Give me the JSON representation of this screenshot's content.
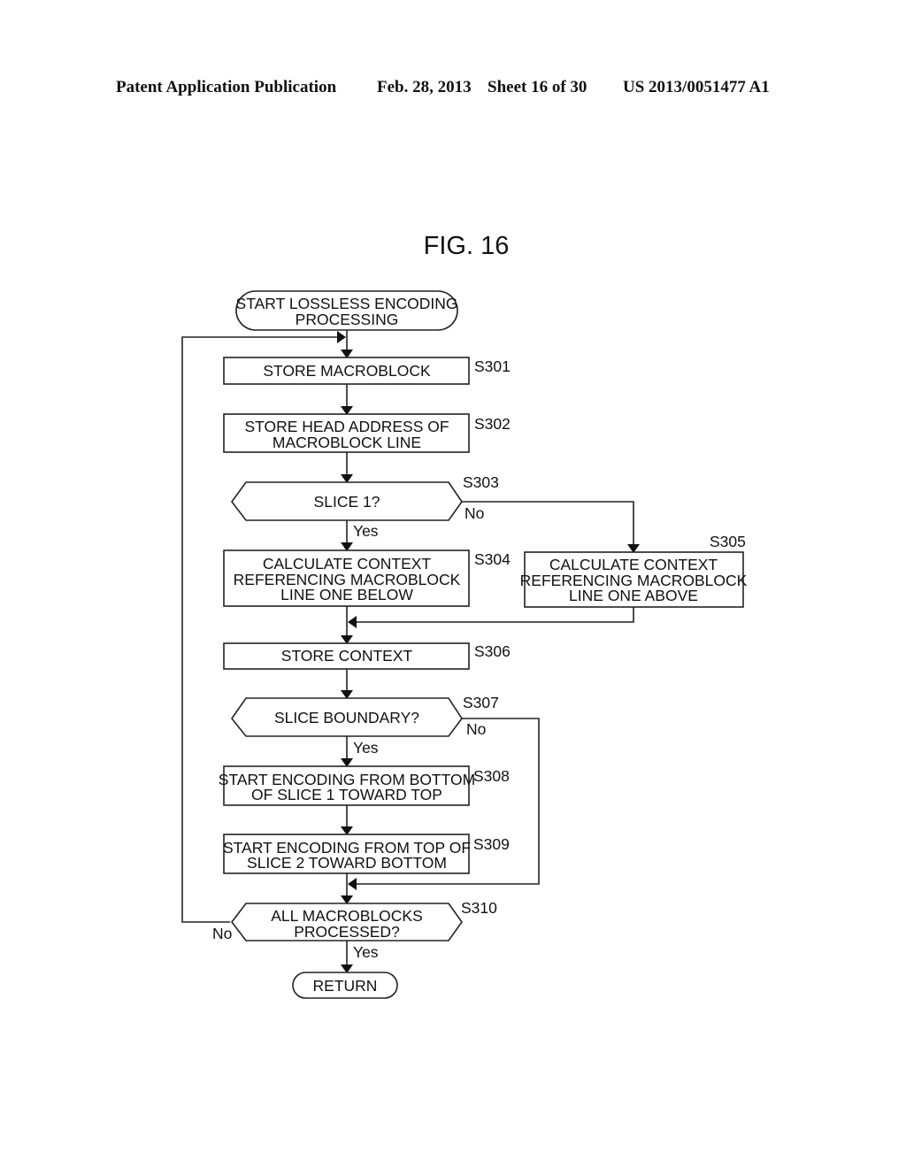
{
  "header": {
    "publication": "Patent Application Publication",
    "date": "Feb. 28, 2013",
    "sheet": "Sheet 16 of 30",
    "number": "US 2013/0051477 A1"
  },
  "figure": {
    "title": "FIG. 16",
    "start": [
      "START LOSSLESS ENCODING",
      "PROCESSING"
    ],
    "end": "RETURN",
    "steps": [
      {
        "id": "S301",
        "type": "process",
        "lines": [
          "STORE MACROBLOCK"
        ]
      },
      {
        "id": "S302",
        "type": "process",
        "lines": [
          "STORE HEAD ADDRESS OF",
          "MACROBLOCK LINE"
        ]
      },
      {
        "id": "S303",
        "type": "decision",
        "lines": [
          "SLICE 1?"
        ],
        "yes": "Yes",
        "no": "No"
      },
      {
        "id": "S304",
        "type": "process",
        "lines": [
          "CALCULATE CONTEXT",
          "REFERENCING MACROBLOCK",
          "LINE ONE BELOW"
        ]
      },
      {
        "id": "S305",
        "type": "process",
        "lines": [
          "CALCULATE CONTEXT",
          "REFERENCING MACROBLOCK",
          "LINE ONE ABOVE"
        ]
      },
      {
        "id": "S306",
        "type": "process",
        "lines": [
          "STORE CONTEXT"
        ]
      },
      {
        "id": "S307",
        "type": "decision",
        "lines": [
          "SLICE BOUNDARY?"
        ],
        "yes": "Yes",
        "no": "No"
      },
      {
        "id": "S308",
        "type": "process",
        "lines": [
          "START ENCODING FROM BOTTOM",
          "OF SLICE 1 TOWARD TOP"
        ]
      },
      {
        "id": "S309",
        "type": "process",
        "lines": [
          "START ENCODING FROM TOP OF",
          "SLICE 2 TOWARD BOTTOM"
        ]
      },
      {
        "id": "S310",
        "type": "decision",
        "lines": [
          "ALL MACROBLOCKS",
          "PROCESSED?"
        ],
        "yes": "Yes",
        "no": "No"
      }
    ]
  }
}
